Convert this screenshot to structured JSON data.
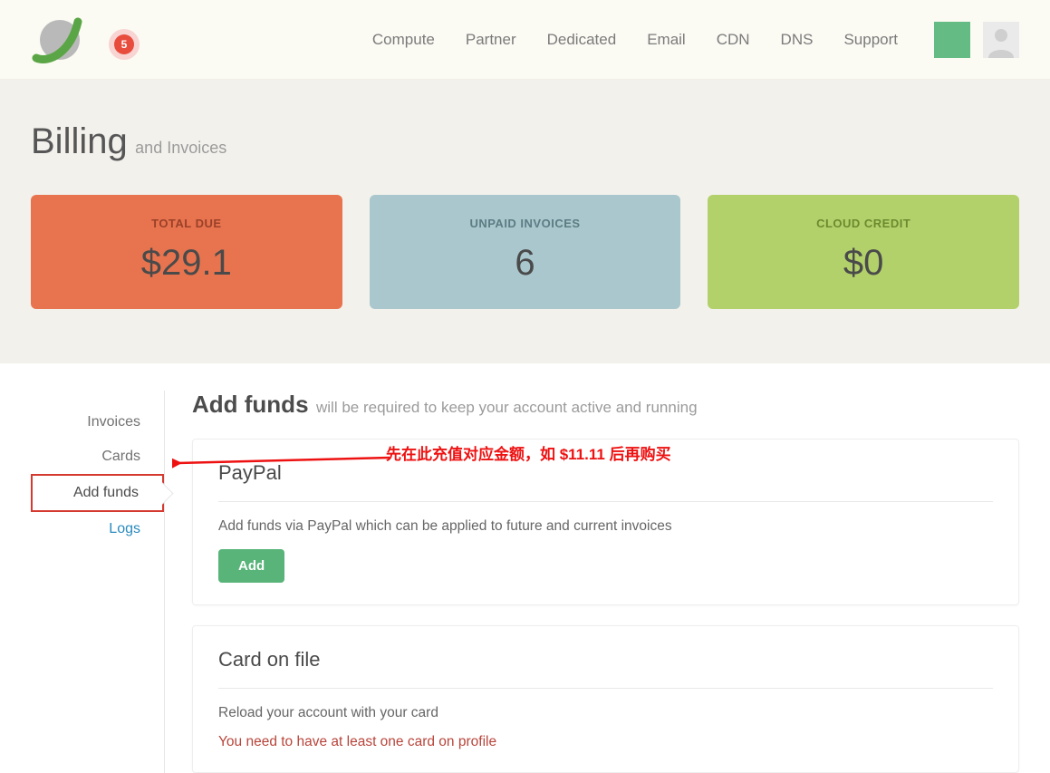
{
  "header": {
    "badge_count": "5",
    "nav": [
      "Compute",
      "Partner",
      "Dedicated",
      "Email",
      "CDN",
      "DNS",
      "Support"
    ]
  },
  "hero": {
    "title_main": "Billing",
    "title_sub": "and Invoices",
    "cards": [
      {
        "label": "TOTAL DUE",
        "value": "$29.1"
      },
      {
        "label": "UNPAID INVOICES",
        "value": "6"
      },
      {
        "label": "CLOUD CREDIT",
        "value": "$0"
      }
    ]
  },
  "sidebar": {
    "items": [
      {
        "label": "Invoices"
      },
      {
        "label": "Cards"
      },
      {
        "label": "Add funds"
      },
      {
        "label": "Logs"
      }
    ],
    "active": "Add funds"
  },
  "section": {
    "title_main": "Add funds",
    "title_sub": "will be required to keep your account active and running"
  },
  "panels": {
    "paypal": {
      "heading": "PayPal",
      "desc": "Add funds via PayPal which can be applied to future and current invoices",
      "button": "Add"
    },
    "card": {
      "heading": "Card on file",
      "desc": "Reload your account with your card",
      "warn": "You need to have at least one card on profile"
    }
  },
  "annotation": {
    "text": "先在此充值对应金额，如 $11.11 后再购买"
  }
}
